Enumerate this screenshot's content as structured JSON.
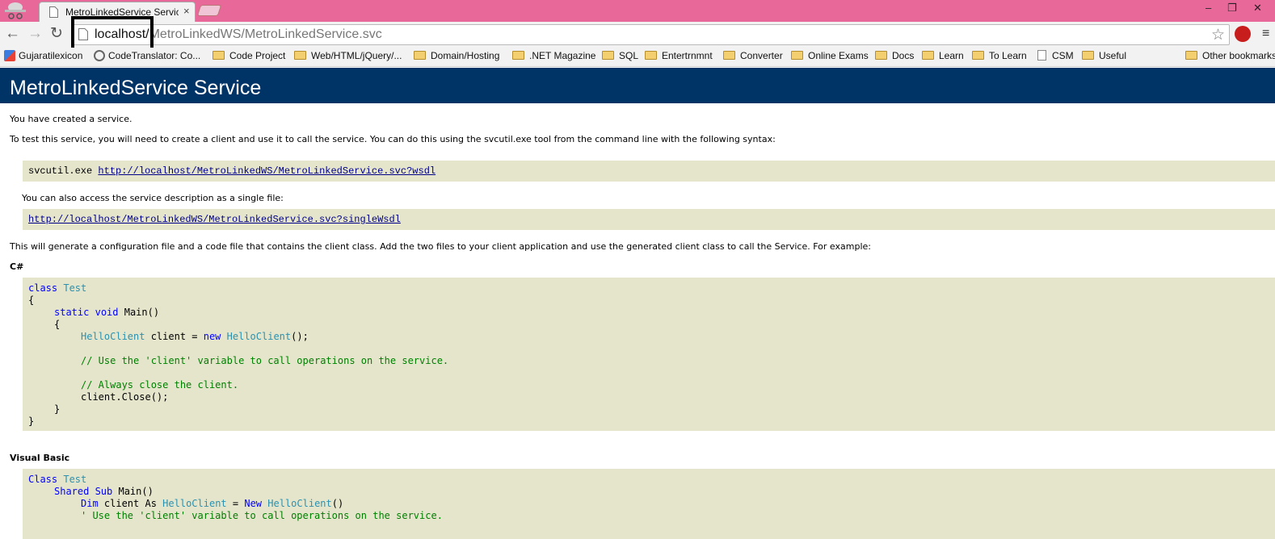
{
  "browser": {
    "tab_title": "MetroLinkedService Service",
    "tab_close": "×",
    "win_minimize": "–",
    "win_restore": "❐",
    "win_close": "✕",
    "back": "←",
    "forward": "→",
    "reload": "↻",
    "url_host": "localhost/",
    "url_path": "MetroLinkedWS/MetroLinkedService.svc",
    "star": "☆",
    "menu": "≡"
  },
  "bookmarks": [
    {
      "label": "Gujaratilexicon",
      "icon": "site-icon"
    },
    {
      "label": "CodeTranslator: Co...",
      "icon": "site-icon"
    },
    {
      "label": "Code Project",
      "icon": "folder-icon"
    },
    {
      "label": "Web/HTML/jQuery/...",
      "icon": "folder-icon"
    },
    {
      "label": "Domain/Hosting",
      "icon": "folder-icon"
    },
    {
      "label": ".NET Magazine",
      "icon": "folder-icon"
    },
    {
      "label": "SQL",
      "icon": "folder-icon"
    },
    {
      "label": "Entertrnmnt",
      "icon": "folder-icon"
    },
    {
      "label": "Converter",
      "icon": "folder-icon"
    },
    {
      "label": "Online Exams",
      "icon": "folder-icon"
    },
    {
      "label": "Docs",
      "icon": "folder-icon"
    },
    {
      "label": "Learn",
      "icon": "folder-icon"
    },
    {
      "label": "To Learn",
      "icon": "folder-icon"
    },
    {
      "label": "CSM",
      "icon": "page-icon"
    },
    {
      "label": "Useful",
      "icon": "folder-icon"
    },
    {
      "label": "Other bookmarks",
      "icon": "folder-icon"
    }
  ],
  "page": {
    "heading": "MetroLinkedService Service",
    "created": "You have created a service.",
    "to_test": "To test this service, you will need to create a client and use it to call the service. You can do this using the svcutil.exe tool from the command line with the following syntax:",
    "svcutil_cmd": "svcutil.exe ",
    "wsdl_link": "http://localhost/MetroLinkedWS/MetroLinkedService.svc?wsdl",
    "single_file": "You can also access the service description as a single file:",
    "single_wsdl_link": "http://localhost/MetroLinkedWS/MetroLinkedService.svc?singleWsdl",
    "generate": "This will generate a configuration file and a code file that contains the client class. Add the two files to your client application and use the generated client class to call the Service. For example:",
    "csharp_label": "C#",
    "vb_label": "Visual Basic"
  },
  "code": {
    "cs": {
      "kw_class": "class",
      "ty_test": "Test",
      "open_brace": "{",
      "indent1_static": "static",
      "kw_void": "void",
      "main": "Main()",
      "inner_open": "{",
      "ty_helloclient": "HelloClient",
      "client_decl": " client = ",
      "kw_new": "new",
      "ty_helloclient2": "HelloClient",
      "call_end": "();",
      "comment1": "// Use the 'client' variable to call operations on the service.",
      "comment2": "// Always close the client.",
      "close_call": "client.Close();",
      "inner_close": "}",
      "close_brace": "}"
    },
    "vb": {
      "kw_class": "Class",
      "ty_test": "Test",
      "kw_shared_sub": "Shared Sub",
      "main": " Main()",
      "kw_dim": "Dim",
      "client_as": " client As ",
      "ty_helloclient": "HelloClient",
      "eq": " = ",
      "kw_new": "New",
      "ty_helloclient2": "HelloClient",
      "parens": "()",
      "comment1": "' Use the 'client' variable to call operations on the service."
    }
  }
}
